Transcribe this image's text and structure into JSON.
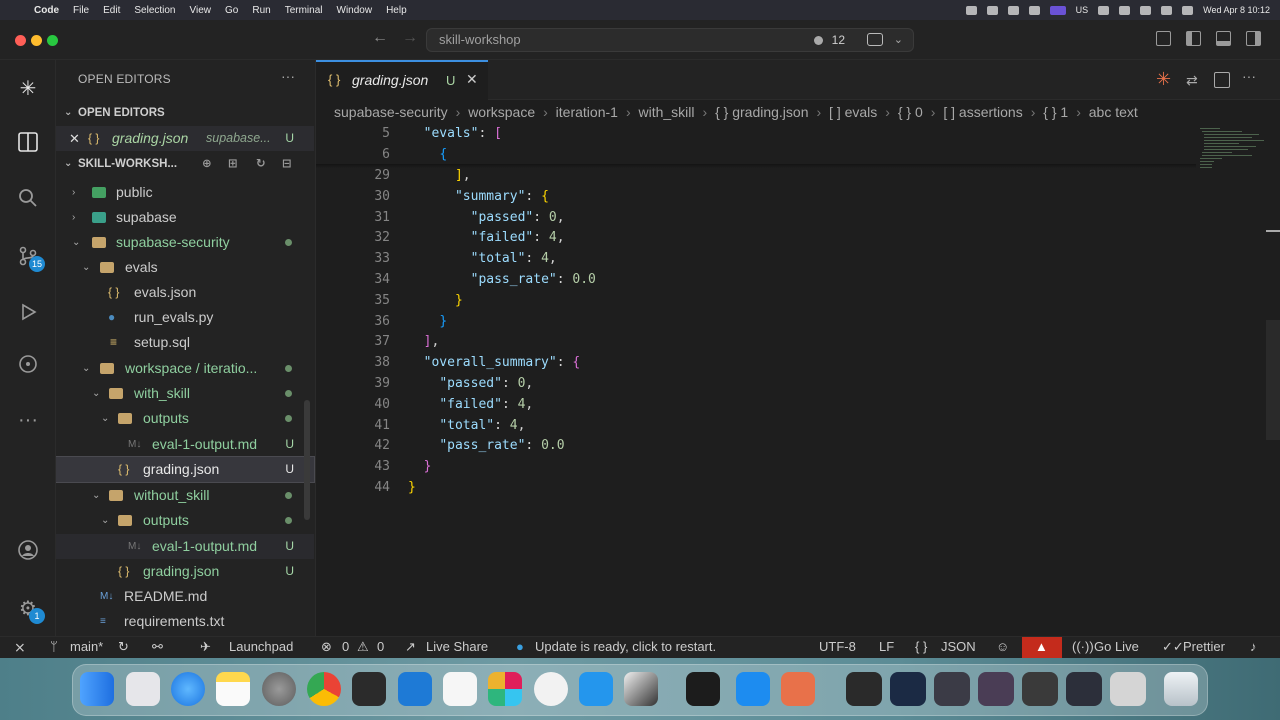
{
  "menubar": {
    "items": [
      "Code",
      "File",
      "Edit",
      "Selection",
      "View",
      "Go",
      "Run",
      "Terminal",
      "Window",
      "Help"
    ],
    "clock": "Wed Apr 8  10:12",
    "input_source": "US"
  },
  "titlebar": {
    "search_text": "skill-workshop",
    "notification_count": "12"
  },
  "activity": {
    "scm_badge": "15",
    "settings_badge": "1",
    "icons": [
      "explorer-icon",
      "search-icon",
      "source-control-icon",
      "run-debug-icon",
      "git-graph-icon",
      "more-icon",
      "accounts-icon",
      "settings-gear-icon"
    ]
  },
  "sidebar": {
    "title": "OPEN EDITORS",
    "open_editors_label": "OPEN EDITORS",
    "open_editor_file": "grading.json",
    "open_editor_path": "supabase...",
    "open_editor_status": "U",
    "workspace_label": "SKILL-WORKSH...",
    "tree": [
      {
        "label": "public",
        "status": ""
      },
      {
        "label": "supabase",
        "status": ""
      },
      {
        "label": "supabase-security",
        "status": ""
      },
      {
        "label": "evals",
        "status": ""
      },
      {
        "label": "evals.json",
        "status": ""
      },
      {
        "label": "run_evals.py",
        "status": ""
      },
      {
        "label": "setup.sql",
        "status": ""
      },
      {
        "label": "workspace / iteratio...",
        "status": ""
      },
      {
        "label": "with_skill",
        "status": ""
      },
      {
        "label": "outputs",
        "status": ""
      },
      {
        "label": "eval-1-output.md",
        "status": "U"
      },
      {
        "label": "grading.json",
        "status": "U"
      },
      {
        "label": "without_skill",
        "status": ""
      },
      {
        "label": "outputs",
        "status": ""
      },
      {
        "label": "eval-1-output.md",
        "status": "U"
      },
      {
        "label": "grading.json",
        "status": "U"
      },
      {
        "label": "README.md",
        "status": ""
      },
      {
        "label": "requirements.txt",
        "status": ""
      }
    ]
  },
  "editor": {
    "tab_label": "grading.json",
    "tab_status": "U",
    "breadcrumb": [
      "supabase-security",
      "workspace",
      "iteration-1",
      "with_skill",
      "{ } grading.json",
      "[ ] evals",
      "{ } 0",
      "[ ] assertions",
      "{ } 1",
      "abc text"
    ],
    "lines": [
      {
        "n": "5",
        "text": "  \"evals\": ["
      },
      {
        "n": "6",
        "text": "    {"
      },
      {
        "n": "29",
        "text": "      ],"
      },
      {
        "n": "30",
        "text": "      \"summary\": {"
      },
      {
        "n": "31",
        "text": "        \"passed\": 0,"
      },
      {
        "n": "32",
        "text": "        \"failed\": 4,"
      },
      {
        "n": "33",
        "text": "        \"total\": 4,"
      },
      {
        "n": "34",
        "text": "        \"pass_rate\": 0.0"
      },
      {
        "n": "35",
        "text": "      }"
      },
      {
        "n": "36",
        "text": "    }"
      },
      {
        "n": "37",
        "text": "  ],"
      },
      {
        "n": "38",
        "text": "  \"overall_summary\": {"
      },
      {
        "n": "39",
        "text": "    \"passed\": 0,"
      },
      {
        "n": "40",
        "text": "    \"failed\": 4,"
      },
      {
        "n": "41",
        "text": "    \"total\": 4,"
      },
      {
        "n": "42",
        "text": "    \"pass_rate\": 0.0"
      },
      {
        "n": "43",
        "text": "  }"
      },
      {
        "n": "44",
        "text": "}"
      }
    ]
  },
  "statusbar": {
    "branch": "main*",
    "launchpad": "Launchpad",
    "errors": "0",
    "warnings": "0",
    "live_share": "Live Share",
    "update": "Update is ready, click to restart.",
    "encoding": "UTF-8",
    "eol": "LF",
    "language": "JSON",
    "go_live": "Go Live",
    "prettier": "Prettier"
  },
  "dock": {
    "apps": [
      "finder-icon",
      "launchpad-icon",
      "safari-icon",
      "notes-icon",
      "system-settings-icon",
      "chrome-icon",
      "cursor-icon",
      "vscode-icon",
      "notion-icon",
      "slack-icon",
      "chatgpt-icon",
      "docker-icon",
      "linear-icon",
      "terminal-icon",
      "docker-desktop-icon",
      "claude-icon"
    ]
  },
  "colors": {
    "accent": "#3c8fe0",
    "untracked": "#aad5a4",
    "json_key": "#9cdcfe",
    "json_number": "#b5cea8",
    "alert": "#c42b1c"
  }
}
